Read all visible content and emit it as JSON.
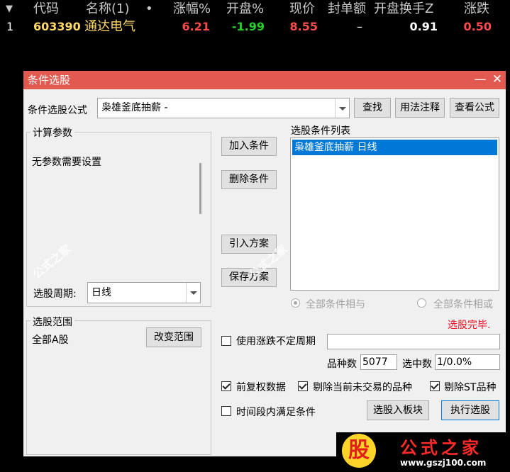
{
  "stock_table": {
    "columns": [
      "代码",
      "名称(1)",
      "•",
      "涨幅%",
      "开盘%",
      "现价",
      "封单额",
      "开盘换手Z",
      "涨跌"
    ],
    "rows": [
      {
        "index": "1",
        "code": "603390",
        "name": "通达电气",
        "change_pct": "6.21",
        "open_pct": "-1.99",
        "price": "8.55",
        "seal_amount": "–",
        "open_turnover": "0.91",
        "change": "0.50"
      }
    ],
    "colors": {
      "header": "#c8c8c8",
      "up": "#ff4b4b",
      "down": "#25d12c",
      "neutral": "#ffffff",
      "code": "#ffd866"
    }
  },
  "dialog": {
    "title": "条件选股",
    "formula_label": "条件选股公式",
    "formula_value": "枭雄釜底抽薪 -",
    "buttons": {
      "find": "查找",
      "usage": "用法注释",
      "view_formula": "查看公式",
      "add_condition": "加入条件",
      "delete_condition": "删除条件",
      "import_plan": "引入方案",
      "save_plan": "保存方案",
      "change_range": "改变范围",
      "to_block": "选股入板块",
      "execute": "执行选股"
    },
    "params_group": {
      "title": "计算参数",
      "text": "无参数需要设置"
    },
    "period": {
      "label": "选股周期:",
      "value": "日线"
    },
    "condition_list": {
      "title": "选股条件列表",
      "items": [
        "枭雄釜底抽薪  日线"
      ]
    },
    "logic": {
      "and_label": "全部条件相与",
      "or_label": "全部条件相或"
    },
    "status": "选股完毕.",
    "range_group": {
      "title": "选股范围",
      "text": "全部A股"
    },
    "use_period": {
      "label": "使用涨跌不定周期",
      "checked": false
    },
    "counts": {
      "total_label": "品种数",
      "total_value": "5077",
      "selected_label": "选中数",
      "selected_value": "1/0.0%"
    },
    "options": {
      "fq_data": {
        "label": "前复权数据",
        "checked": true
      },
      "exclude_untraded": {
        "label": "剔除当前未交易的品种",
        "checked": true
      },
      "exclude_st": {
        "label": "剔除ST品种",
        "checked": true
      },
      "period_satisfy": {
        "label": "时间段内满足条件",
        "checked": false
      }
    },
    "colors": {
      "titlebar": "#e2594f",
      "selection": "#0078d7",
      "status": "#e81123"
    }
  },
  "watermark": {
    "text": "公式之家",
    "url": "www.gszj100.com",
    "logo_char": "股"
  }
}
